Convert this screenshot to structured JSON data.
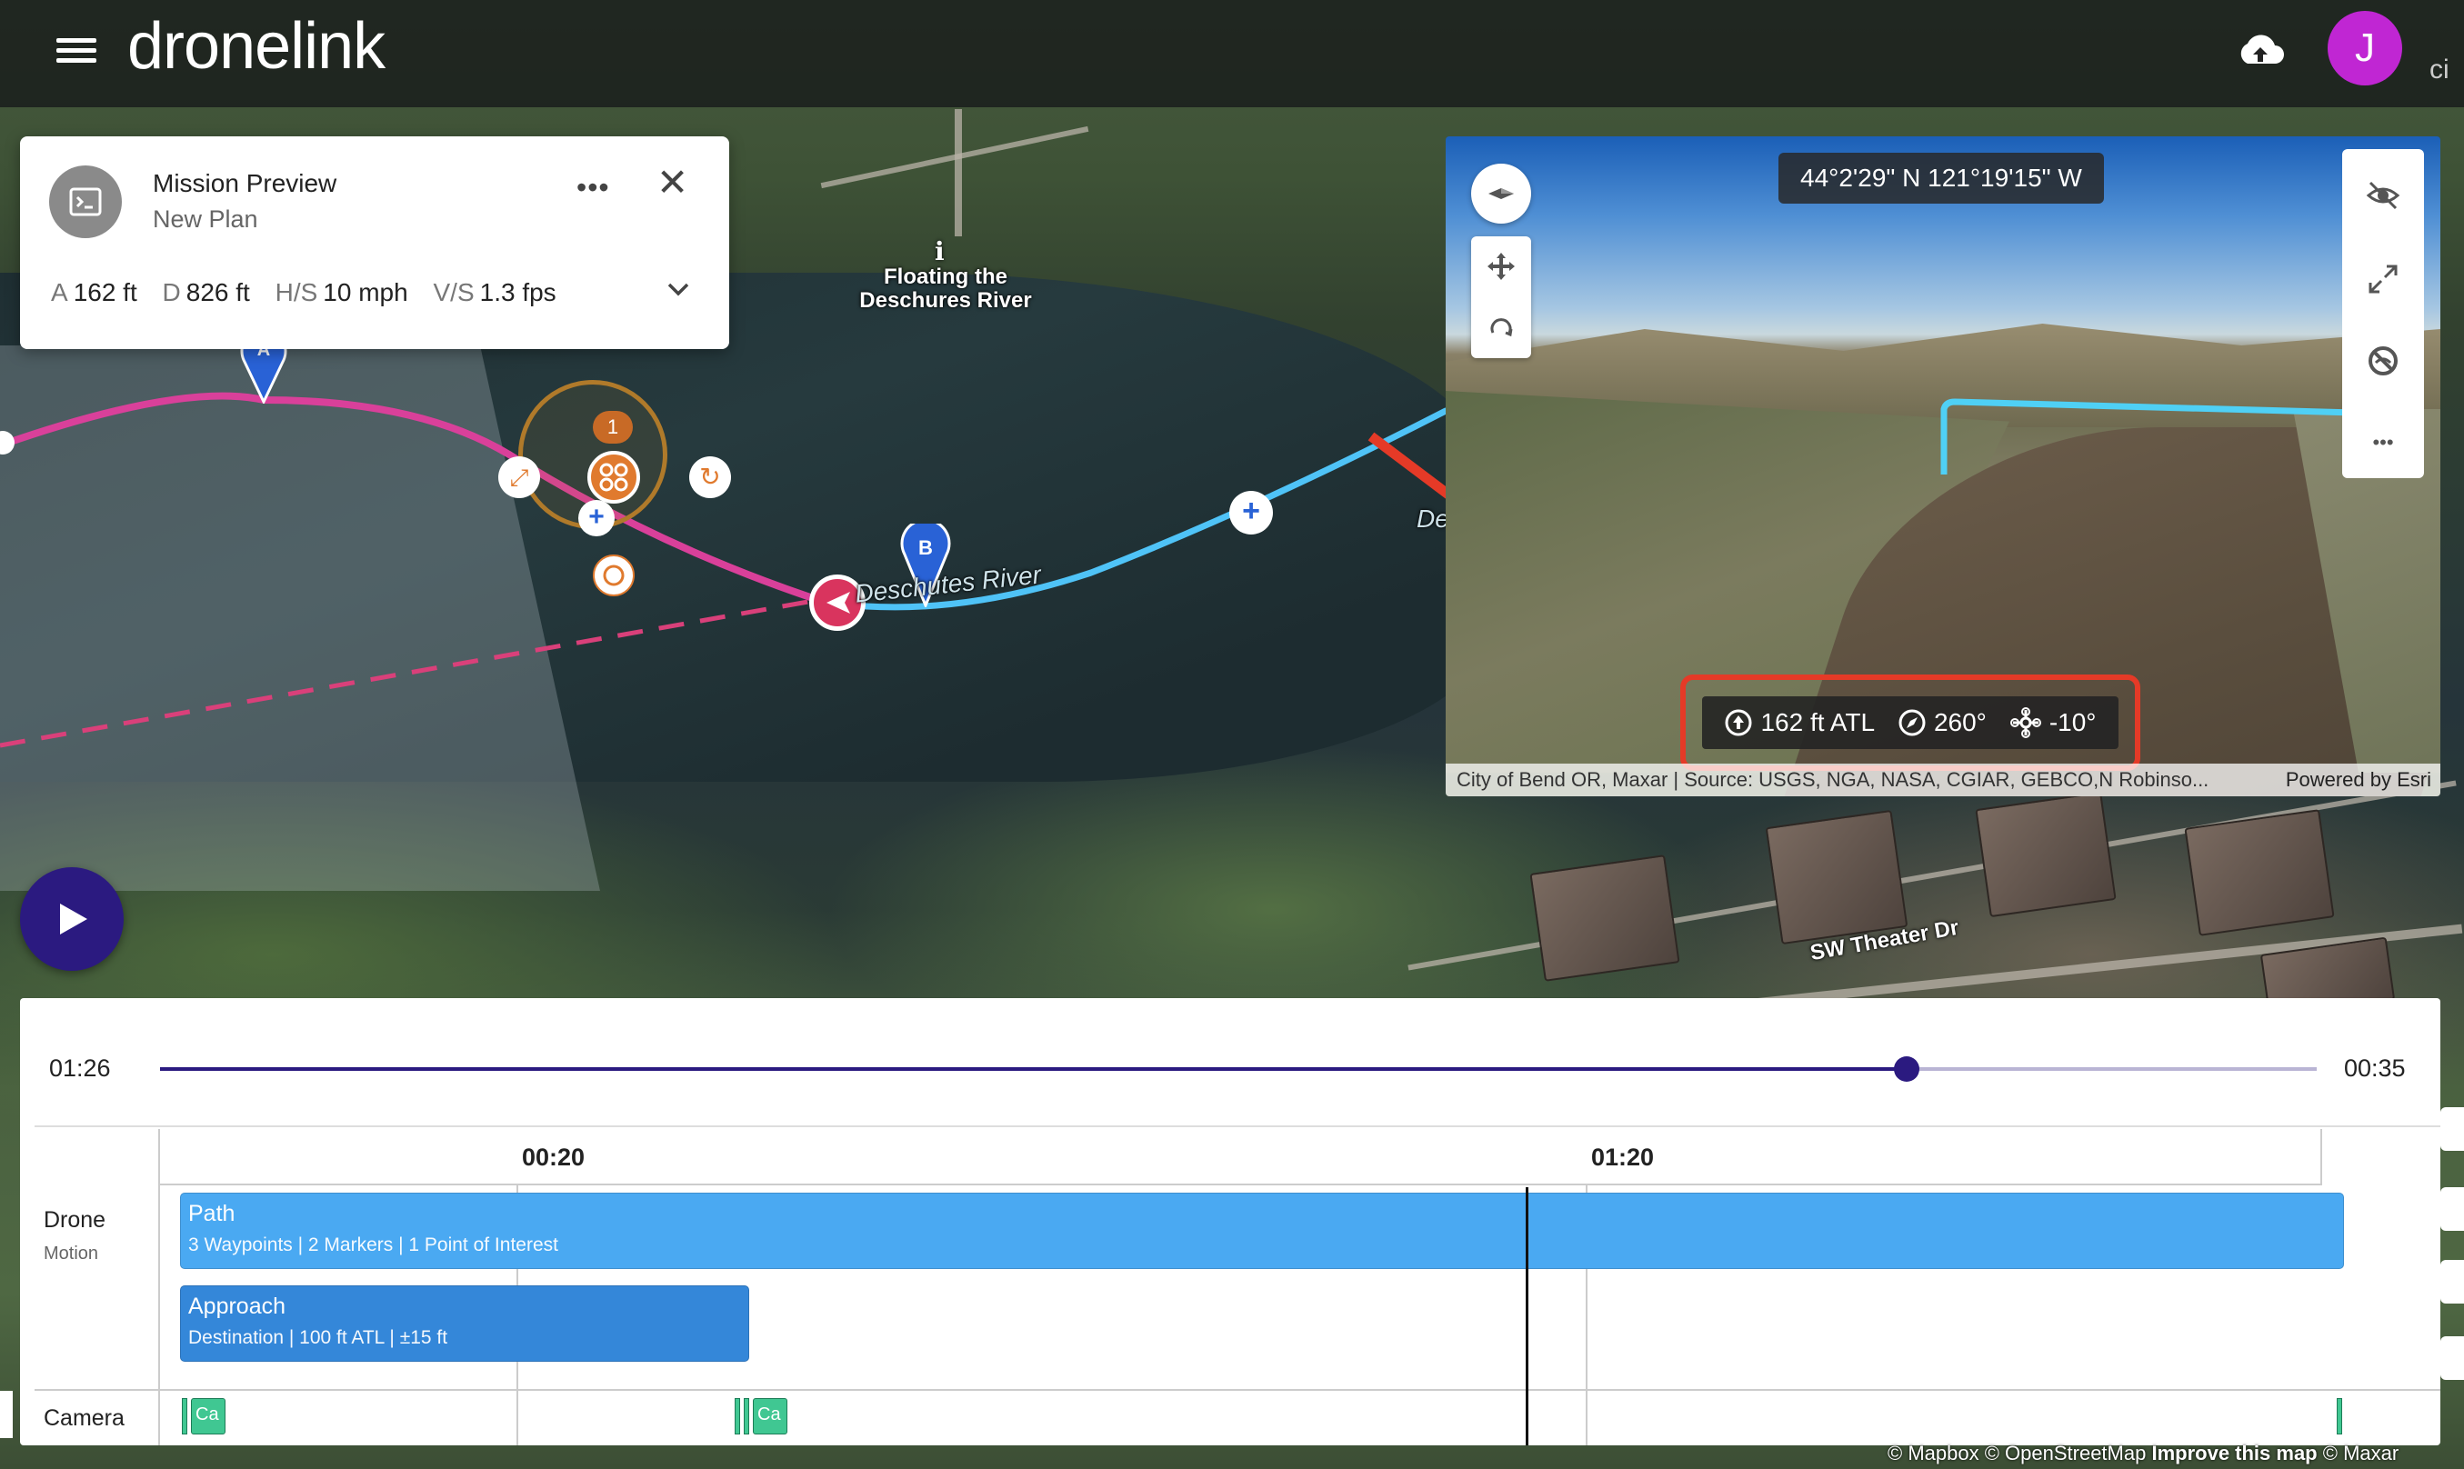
{
  "app": {
    "logo": "dronelink",
    "avatar_initial": "J",
    "tab_stub": "ci"
  },
  "mission": {
    "title": "Mission Preview",
    "subtitle": "New Plan",
    "more_label": "•••",
    "close_label": "✕",
    "stats": [
      {
        "key": "A",
        "value": "162 ft"
      },
      {
        "key": "D",
        "value": "826 ft"
      },
      {
        "key": "H/S",
        "value": "10 mph"
      },
      {
        "key": "V/S",
        "value": "1.3 fps"
      }
    ]
  },
  "map": {
    "poi_label": "Floating the\nDeschures River",
    "river_label": "Deschutes River",
    "river_label_2": "De",
    "street_label": "SW Theater Dr",
    "marker_b": "B",
    "marker_a": "A",
    "focus_badge": "1",
    "attribution_1": "© Mapbox © OpenStreetMap",
    "attribution_link": "Improve this map",
    "attribution_2": "© Maxar"
  },
  "view3d": {
    "coordinates": "44°2'29\" N 121°19'15\" W",
    "telemetry": {
      "altitude": "162 ft ATL",
      "heading": "260°",
      "gimbal": "-10°"
    },
    "attribution": "City of Bend OR, Maxar | Source: USGS, NGA, NASA, CGIAR, GEBCO,N Robinso...",
    "powered_by": "Powered by Esri",
    "more_label": "•••"
  },
  "timeline": {
    "start_time": "01:26",
    "end_time": "00:35",
    "progress": 0.81,
    "ruler_ticks": [
      "00:20",
      "01:20"
    ],
    "rows": {
      "drone_label": "Drone",
      "drone_sub": "Motion",
      "camera_label": "Camera"
    },
    "tracks": {
      "path_title": "Path",
      "path_sub": "3 Waypoints | 2 Markers | 1 Point of Interest",
      "approach_title": "Approach",
      "approach_sub": "Destination | 100 ft ATL | ±15 ft"
    },
    "camera_clips": [
      "Ca",
      "Ca"
    ]
  },
  "colors": {
    "brand_primary": "#2b1a80",
    "avatar": "#c026d3",
    "path_track": "#4aa9f2",
    "approach_track": "#3487d9",
    "camera_clip": "#40c792",
    "flight_path_pink": "#d9409a",
    "flight_path_blue": "#4fc3f7",
    "highlight_red": "#e53a27",
    "focus_orange": "#e07a2e"
  }
}
